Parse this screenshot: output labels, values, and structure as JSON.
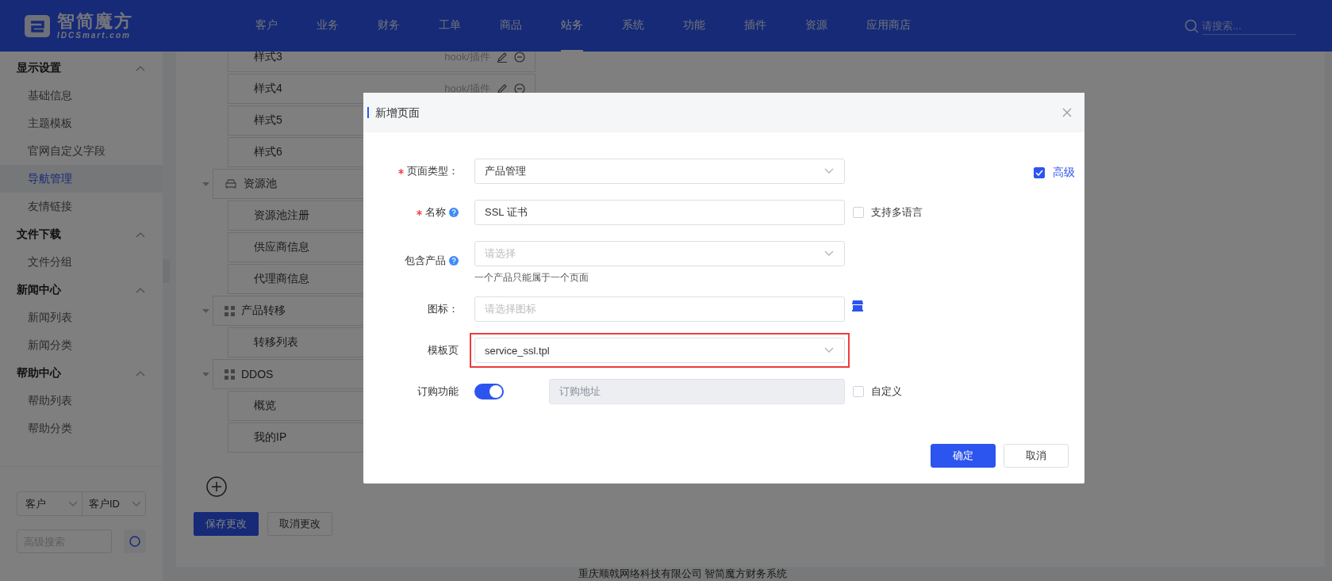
{
  "header": {
    "logo": {
      "name": "智简魔方",
      "sub": "IDCSmart.com"
    },
    "nav": [
      {
        "label": "客户",
        "selected": false
      },
      {
        "label": "业务",
        "selected": false
      },
      {
        "label": "财务",
        "selected": false
      },
      {
        "label": "工单",
        "selected": false
      },
      {
        "label": "商品",
        "selected": false
      },
      {
        "label": "站务",
        "selected": true
      },
      {
        "label": "系统",
        "selected": false
      },
      {
        "label": "功能",
        "selected": false
      },
      {
        "label": "插件",
        "selected": false
      },
      {
        "label": "资源",
        "selected": false
      },
      {
        "label": "应用商店",
        "selected": false
      }
    ],
    "search": {
      "placeholder": "请搜索..."
    }
  },
  "sidebar": {
    "groups": [
      {
        "title": "显示设置",
        "expanded": true,
        "items": [
          {
            "label": "基础信息",
            "selected": false
          },
          {
            "label": "主题模板",
            "selected": false
          },
          {
            "label": "官网自定义字段",
            "selected": false
          },
          {
            "label": "导航管理",
            "selected": true
          },
          {
            "label": "友情链接",
            "selected": false
          }
        ]
      },
      {
        "title": "文件下载",
        "expanded": true,
        "items": [
          {
            "label": "文件分组",
            "selected": false
          }
        ]
      },
      {
        "title": "新闻中心",
        "expanded": true,
        "items": [
          {
            "label": "新闻列表",
            "selected": false
          },
          {
            "label": "新闻分类",
            "selected": false
          }
        ]
      },
      {
        "title": "帮助中心",
        "expanded": true,
        "items": [
          {
            "label": "帮助列表",
            "selected": false
          },
          {
            "label": "帮助分类",
            "selected": false
          }
        ]
      }
    ],
    "filter": {
      "selects": [
        "客户",
        "客户ID"
      ],
      "search": {
        "placeholder": "高级搜索"
      }
    }
  },
  "tree": {
    "continued_children": [
      {
        "label": "样式3",
        "meta": "hook/插件"
      },
      {
        "label": "样式4",
        "meta": "hook/插件"
      },
      {
        "label": "样式5"
      },
      {
        "label": "样式6"
      }
    ],
    "nodes": [
      {
        "label": "资源池",
        "expanded": true,
        "children": [
          {
            "label": "资源池注册"
          },
          {
            "label": "供应商信息"
          },
          {
            "label": "代理商信息"
          }
        ]
      },
      {
        "label": "产品转移",
        "expanded": true,
        "children": [
          {
            "label": "转移列表"
          }
        ]
      },
      {
        "label": "DDOS",
        "expanded": true,
        "children": [
          {
            "label": "概览"
          },
          {
            "label": "我的IP"
          }
        ]
      }
    ],
    "buttons": [
      {
        "label": "保存更改",
        "kind": "primary"
      },
      {
        "label": "取消更改",
        "kind": "default"
      }
    ]
  },
  "footer": "重庆顺戟网络科技有限公司 智简魔方财务系统",
  "modal": {
    "title": "新增页面",
    "advanced": {
      "label": "高级",
      "checked": true
    },
    "fields": [
      {
        "kind": "select",
        "label": "页面类型：",
        "required": true,
        "value": "产品管理"
      },
      {
        "kind": "input",
        "label": "名称",
        "required": true,
        "help": true,
        "value": "SSL 证书",
        "checkbox": {
          "label": "支持多语言",
          "checked": false
        }
      },
      {
        "kind": "select",
        "label": "包含产品",
        "help": true,
        "placeholder": "请选择",
        "hint": "一个产品只能属于一个页面"
      },
      {
        "kind": "icon-input",
        "label": "图标：",
        "placeholder": "请选择图标"
      },
      {
        "kind": "select",
        "label": "模板页",
        "value": "service_ssl.tpl",
        "highlighted": true
      },
      {
        "kind": "toggle",
        "label": "订购功能",
        "on": true,
        "placeholder": "订购地址",
        "disabled": true,
        "checkbox": {
          "label": "自定义",
          "checked": false
        }
      }
    ],
    "buttons": [
      {
        "label": "确定",
        "kind": "primary"
      },
      {
        "label": "取消",
        "kind": "default"
      }
    ]
  }
}
